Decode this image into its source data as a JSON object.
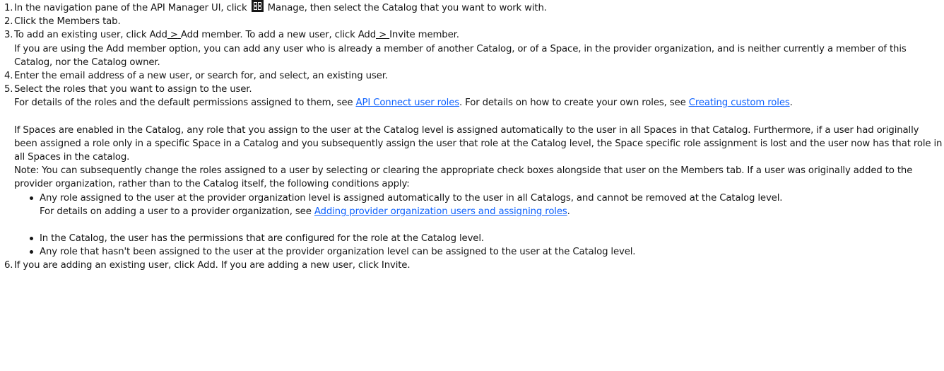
{
  "steps": {
    "s1": {
      "num": "1.",
      "pre": "In the navigation pane of the API Manager UI, click",
      "icon": "grid-icon",
      "post": "Manage, then select the Catalog that you want to work with."
    },
    "s2": {
      "num": "2.",
      "text": "Click the Members tab."
    },
    "s3": {
      "num": "3.",
      "a": "To add an existing user, click Add",
      "gt": ">",
      "b": "Add member. To add a new user, click Add",
      "c": "Invite member.",
      "note": "If you are using the Add member option, you can add any user who is already a member of another Catalog, or of a Space, in the provider organization, and is neither currently a member of this Catalog, nor the Catalog owner."
    },
    "s4": {
      "num": "4.",
      "text": "Enter the email address of a new user, or search for, and select, an existing user."
    },
    "s5": {
      "num": "5.",
      "text": "Select the roles that you want to assign to the user.",
      "details_pre": "For details of the roles and the default permissions assigned to them, see",
      "link1": "API Connect user roles",
      "details_mid": ". For details on how to create your own roles, see",
      "link2": "Creating custom roles",
      "details_post": ".",
      "para1": "If Spaces are enabled in the Catalog, any role that you assign to the user at the Catalog level is assigned automatically to the user in all Spaces in that Catalog. Furthermore, if a user had originally been assigned a role only in a specific Space in a Catalog and you subsequently assign the user that role at the Catalog level, the Space specific role assignment is lost and the user now has that role in all Spaces in the catalog.",
      "note": "Note: You can subsequently change the roles assigned to a user by selecting or clearing the appropriate check boxes alongside that user on the Members tab. If a user was originally added to the provider organization, rather than to the Catalog itself, the following conditions apply:",
      "bullet1": "Any role assigned to the user at the provider organization level is assigned automatically to the user in all Catalogs, and cannot be removed at the Catalog level.",
      "bullet1_pre": "For details on adding a user to a provider organization, see",
      "bullet1_link": "Adding provider organization users and assigning roles",
      "bullet1_post": ".",
      "bullet2": "In the Catalog, the user has the permissions that are configured for the role at the Catalog level.",
      "bullet3": "Any role that hasn't been assigned to the user at the provider organization level can be assigned to the user at the Catalog level."
    },
    "s6": {
      "num": "6.",
      "text": "If you are adding an existing user, click Add. If you are adding a new user, click Invite."
    }
  }
}
